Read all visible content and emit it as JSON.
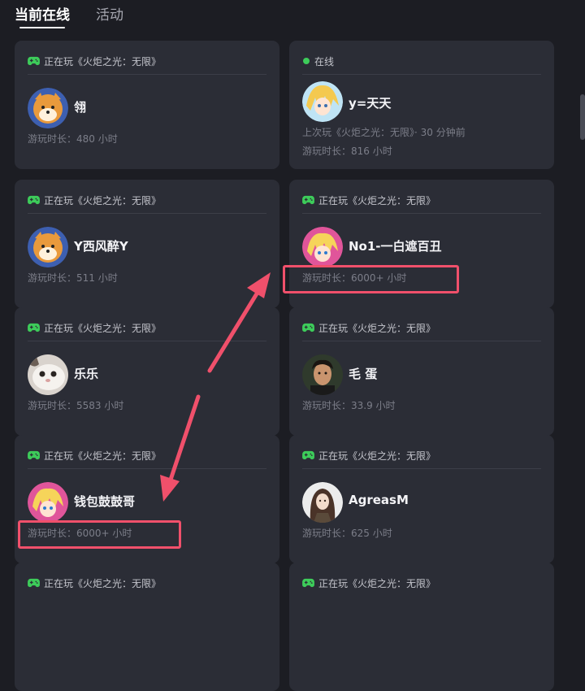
{
  "tabs": {
    "current_online": "当前在线",
    "activity": "活动"
  },
  "colors": {
    "playing_green": "#3dcc5a",
    "online_dot": "#3dcc5a",
    "highlight_red": "#f0506b"
  },
  "cards": [
    {
      "status": "正在玩《火炬之光：无限》",
      "status_icon": "gamepad-icon",
      "name": "翎",
      "playtime": "游玩时长：480 小时"
    },
    {
      "status": "在线",
      "status_icon": "online-dot",
      "name": "y=天天",
      "last_played": "上次玩《火炬之光：无限》· 30 分钟前",
      "playtime": "游玩时长：816 小时"
    },
    {
      "status": "正在玩《火炬之光：无限》",
      "status_icon": "gamepad-icon",
      "name": "Y西风醉Y",
      "playtime": "游玩时长：511 小时"
    },
    {
      "status": "正在玩《火炬之光：无限》",
      "status_icon": "gamepad-icon",
      "name": "No1-一白遮百丑",
      "playtime": "游玩时长：6000+ 小时"
    },
    {
      "status": "正在玩《火炬之光：无限》",
      "status_icon": "gamepad-icon",
      "name": "乐乐",
      "playtime": "游玩时长：5583 小时"
    },
    {
      "status": "正在玩《火炬之光：无限》",
      "status_icon": "gamepad-icon",
      "name": "毛 蛋",
      "playtime": "游玩时长：33.9 小时"
    },
    {
      "status": "正在玩《火炬之光：无限》",
      "status_icon": "gamepad-icon",
      "name": "钱包鼓鼓哥",
      "playtime": "游玩时长：6000+ 小时"
    },
    {
      "status": "正在玩《火炬之光：无限》",
      "status_icon": "gamepad-icon",
      "name": "AgreasM",
      "playtime": "游玩时长：625 小时"
    },
    {
      "status": "正在玩《火炬之光：无限》",
      "status_icon": "gamepad-icon"
    },
    {
      "status": "正在玩《火炬之光：无限》",
      "status_icon": "gamepad-icon"
    }
  ]
}
